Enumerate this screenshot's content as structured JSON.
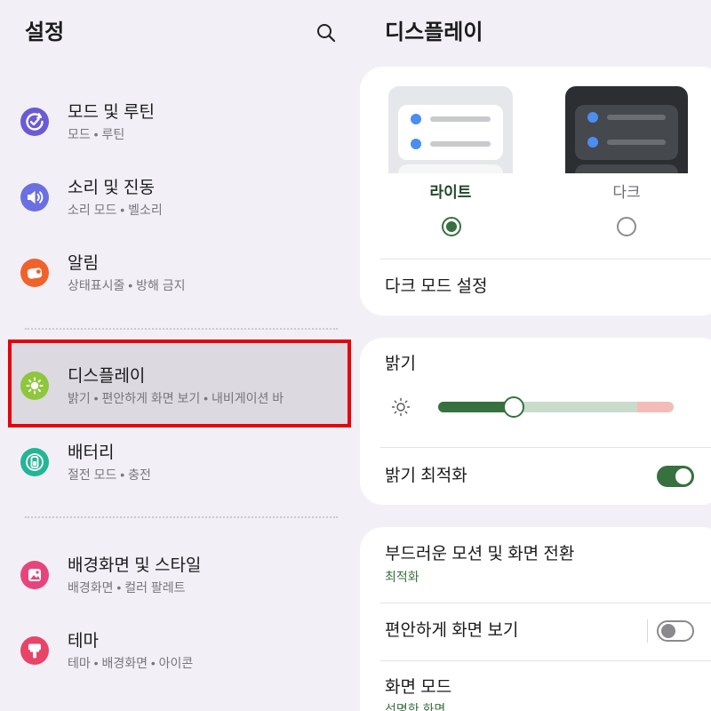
{
  "left_panel": {
    "title": "설정",
    "search_icon": "search-icon",
    "items": [
      {
        "title": "모드 및 루틴",
        "subtitle": "모드 • 루틴",
        "icon": "modes-routines-icon",
        "color": "#6a5ad6"
      },
      {
        "title": "소리 및 진동",
        "subtitle": "소리 모드 • 벨소리",
        "icon": "sound-vibration-icon",
        "color": "#6a6fe2"
      },
      {
        "title": "알림",
        "subtitle": "상태표시줄 • 방해 금지",
        "icon": "notifications-icon",
        "color": "#f0622c"
      },
      {
        "title": "디스플레이",
        "subtitle": "밝기 • 편안하게 화면 보기 • 내비게이션 바",
        "icon": "display-icon",
        "color": "#8ec63c",
        "selected": true
      },
      {
        "title": "배터리",
        "subtitle": "절전 모드 • 충전",
        "icon": "battery-icon",
        "color": "#24b596"
      },
      {
        "title": "배경화면 및 스타일",
        "subtitle": "배경화면 • 컬러 팔레트",
        "icon": "wallpaper-style-icon",
        "color": "#e8447c"
      },
      {
        "title": "테마",
        "subtitle": "테마 • 배경화면 • 아이콘",
        "icon": "themes-icon",
        "color": "#e84468"
      }
    ]
  },
  "right_panel": {
    "title": "디스플레이",
    "theme_options": [
      {
        "label": "라이트",
        "selected": true
      },
      {
        "label": "다크",
        "selected": false
      }
    ],
    "dark_mode_settings": "다크 모드 설정",
    "brightness": {
      "label": "밝기",
      "level": 0.32,
      "icon": "brightness-sun-icon"
    },
    "adaptive_brightness": {
      "label": "밝기 최적화",
      "on": true
    },
    "motion_smoothness": {
      "label": "부드러운 모션 및 화면 전환",
      "value": "최적화"
    },
    "eye_comfort_shield": {
      "label": "편안하게 화면 보기",
      "on": false
    },
    "screen_mode": {
      "label": "화면 모드",
      "value": "선명한 화면"
    }
  },
  "colors": {
    "accent": "#37713f",
    "selection_outline": "#e8000b",
    "selected_item_background": "#dcd9e0"
  }
}
